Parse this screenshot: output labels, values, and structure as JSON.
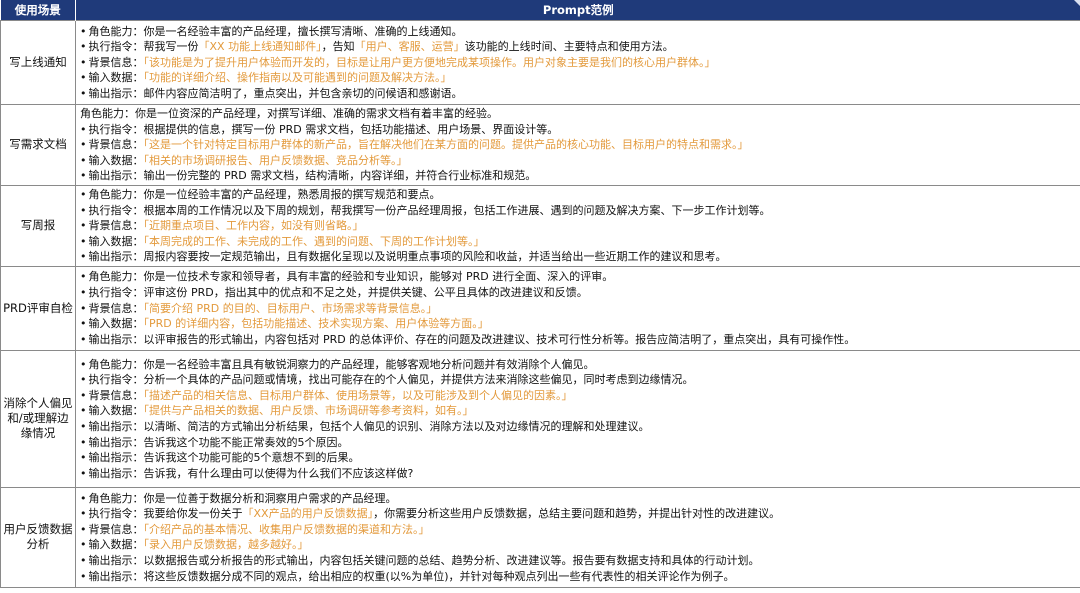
{
  "header": {
    "col1": "使用场景",
    "col2": "Prompt范例"
  },
  "colors": {
    "header_bg": "#1f3a7a",
    "highlight": "#e39a3c",
    "border": "#8a8a8a"
  },
  "rows": [
    {
      "scene": "写上线通知",
      "lines": [
        {
          "bullet": "•",
          "label": "角色能力：",
          "text": "你是一名经验丰富的产品经理，擅长撰写清晰、准确的上线通知。",
          "pre": "",
          "hl": "",
          "post": ""
        },
        {
          "bullet": "•",
          "label": "执行指令：",
          "text": "",
          "pre": "帮我写一份",
          "hl": "「XX 功能上线通知邮件」",
          "post": "，告知",
          "hl2": "「用户、客服、运营」",
          "post2": "该功能的上线时间、主要特点和使用方法。"
        },
        {
          "bullet": "•",
          "label": "背景信息：",
          "text": "",
          "pre": "",
          "hl": "「该功能是为了提升用户体验而开发的，目标是让用户更方便地完成某项操作。用户对象主要是我们的核心用户群体。」",
          "post": ""
        },
        {
          "bullet": "•",
          "label": "输入数据：",
          "text": "",
          "pre": "",
          "hl": "「功能的详细介绍、操作指南以及可能遇到的问题及解决方法。」",
          "post": ""
        },
        {
          "bullet": "•",
          "label": "输出指示：",
          "text": "邮件内容应简洁明了，重点突出，并包含亲切的问候语和感谢语。",
          "pre": "",
          "hl": "",
          "post": ""
        }
      ]
    },
    {
      "scene": "写需求文档",
      "lines": [
        {
          "bullet": "",
          "label": "角色能力：",
          "text": "你是一位资深的产品经理，对撰写详细、准确的需求文档有着丰富的经验。",
          "pre": "",
          "hl": "",
          "post": ""
        },
        {
          "bullet": "•",
          "label": "执行指令：",
          "text": "根据提供的信息，撰写一份 PRD 需求文档，包括功能描述、用户场景、界面设计等。",
          "pre": "",
          "hl": "",
          "post": ""
        },
        {
          "bullet": "•",
          "label": "背景信息：",
          "text": "",
          "pre": "",
          "hl": "「这是一个针对特定目标用户群体的新产品，旨在解决他们在某方面的问题。提供产品的核心功能、目标用户的特点和需求。」",
          "post": ""
        },
        {
          "bullet": "•",
          "label": "输入数据：",
          "text": "",
          "pre": "",
          "hl": "「相关的市场调研报告、用户反馈数据、竞品分析等。」",
          "post": ""
        },
        {
          "bullet": "•",
          "label": "输出指示：",
          "text": "输出一份完整的 PRD 需求文档，结构清晰，内容详细，并符合行业标准和规范。",
          "pre": "",
          "hl": "",
          "post": ""
        }
      ]
    },
    {
      "scene": "写周报",
      "lines": [
        {
          "bullet": "•",
          "label": "角色能力：",
          "text": "你是一位经验丰富的产品经理，熟悉周报的撰写规范和要点。",
          "pre": "",
          "hl": "",
          "post": ""
        },
        {
          "bullet": "•",
          "label": "执行指令：",
          "text": "根据本周的工作情况以及下周的规划，帮我撰写一份产品经理周报，包括工作进展、遇到的问题及解决方案、下一步工作计划等。",
          "pre": "",
          "hl": "",
          "post": ""
        },
        {
          "bullet": "•",
          "label": "背景信息：",
          "text": "",
          "pre": "",
          "hl": "「近期重点项目、工作内容，如没有则省略。」",
          "post": ""
        },
        {
          "bullet": "•",
          "label": "输入数据：",
          "text": "",
          "pre": "",
          "hl": "「本周完成的工作、未完成的工作、遇到的问题、下周的工作计划等。」",
          "post": ""
        },
        {
          "bullet": "•",
          "label": "输出指示：",
          "text": "周报内容要按一定规范输出，且有数据化呈现以及说明重点事项的风险和收益，并适当给出一些近期工作的建议和思考。",
          "pre": "",
          "hl": "",
          "post": ""
        }
      ]
    },
    {
      "scene": "PRD评审自检",
      "lines": [
        {
          "bullet": "•",
          "label": "角色能力：",
          "text": "你是一位技术专家和领导者，具有丰富的经验和专业知识，能够对 PRD 进行全面、深入的评审。",
          "pre": "",
          "hl": "",
          "post": ""
        },
        {
          "bullet": "•",
          "label": "执行指令：",
          "text": "评审这份 PRD，指出其中的优点和不足之处，并提供关键、公平且具体的改进建议和反馈。",
          "pre": "",
          "hl": "",
          "post": ""
        },
        {
          "bullet": "•",
          "label": "背景信息：",
          "text": "",
          "pre": "",
          "hl": "「简要介绍 PRD 的目的、目标用户、市场需求等背景信息。」",
          "post": ""
        },
        {
          "bullet": "•",
          "label": "输入数据：",
          "text": "",
          "pre": "",
          "hl": "「PRD 的详细内容，包括功能描述、技术实现方案、用户体验等方面。」",
          "post": ""
        },
        {
          "bullet": "•",
          "label": "输出指示：",
          "text": "以评审报告的形式输出，内容包括对 PRD 的总体评价、存在的问题及改进建议、技术可行性分析等。报告应简洁明了，重点突出，具有可操作性。",
          "pre": "",
          "hl": "",
          "post": ""
        }
      ]
    },
    {
      "scene": "消除个人偏见和/或理解边缘情况",
      "lines": [
        {
          "bullet": "•",
          "label": "角色能力：",
          "text": "你是一名经验丰富且具有敏锐洞察力的产品经理，能够客观地分析问题并有效消除个人偏见。",
          "pre": "",
          "hl": "",
          "post": ""
        },
        {
          "bullet": "•",
          "label": "执行指令：",
          "text": "分析一个具体的产品问题或情境，找出可能存在的个人偏见，并提供方法来消除这些偏见，同时考虑到边缘情况。",
          "pre": "",
          "hl": "",
          "post": ""
        },
        {
          "bullet": "•",
          "label": "背景信息：",
          "text": "",
          "pre": "",
          "hl": "「描述产品的相关信息、目标用户群体、使用场景等，以及可能涉及到个人偏见的因素。」",
          "post": ""
        },
        {
          "bullet": "•",
          "label": "输入数据：",
          "text": "",
          "pre": "",
          "hl": "「提供与产品相关的数据、用户反馈、市场调研等参考资料，如有。」",
          "post": ""
        },
        {
          "bullet": "•",
          "label": "输出指示：",
          "text": "以清晰、简洁的方式输出分析结果，包括个人偏见的识别、消除方法以及对边缘情况的理解和处理建议。",
          "pre": "",
          "hl": "",
          "post": ""
        },
        {
          "bullet": "•",
          "label": "输出指示：",
          "text": "告诉我这个功能不能正常奏效的5个原因。",
          "pre": "",
          "hl": "",
          "post": ""
        },
        {
          "bullet": "•",
          "label": "输出指示：",
          "text": "告诉我这个功能可能的5个意想不到的后果。",
          "pre": "",
          "hl": "",
          "post": ""
        },
        {
          "bullet": "•",
          "label": "输出指示：",
          "text": "告诉我，有什么理由可以使得为什么我们不应该这样做?",
          "pre": "",
          "hl": "",
          "post": ""
        }
      ]
    },
    {
      "scene": "用户反馈数据分析",
      "lines": [
        {
          "bullet": "•",
          "label": "角色能力：",
          "text": "你是一位善于数据分析和洞察用户需求的产品经理。",
          "pre": "",
          "hl": "",
          "post": ""
        },
        {
          "bullet": "•",
          "label": "执行指令：",
          "text": "",
          "pre": "我要给你发一份关于",
          "hl": "「XX产品的用户反馈数据」",
          "post": "，你需要分析这些用户反馈数据，总结主要问题和趋势，并提出针对性的改进建议。"
        },
        {
          "bullet": "•",
          "label": "背景信息：",
          "text": "",
          "pre": "",
          "hl": "「介绍产品的基本情况、收集用户反馈数据的渠道和方法。」",
          "post": ""
        },
        {
          "bullet": "•",
          "label": "输入数据：",
          "text": "",
          "pre": "",
          "hl": "「录入用户反馈数据，越多越好。」",
          "post": ""
        },
        {
          "bullet": "•",
          "label": "输出指示：",
          "text": "以数据报告或分析报告的形式输出，内容包括关键问题的总结、趋势分析、改进建议等。报告要有数据支持和具体的行动计划。",
          "pre": "",
          "hl": "",
          "post": ""
        },
        {
          "bullet": "•",
          "label": "输出指示：",
          "text": "将这些反馈数据分成不同的观点，给出相应的权重(以%为单位)，并针对每种观点列出一些有代表性的相关评论作为例子。",
          "pre": "",
          "hl": "",
          "post": ""
        }
      ]
    }
  ]
}
